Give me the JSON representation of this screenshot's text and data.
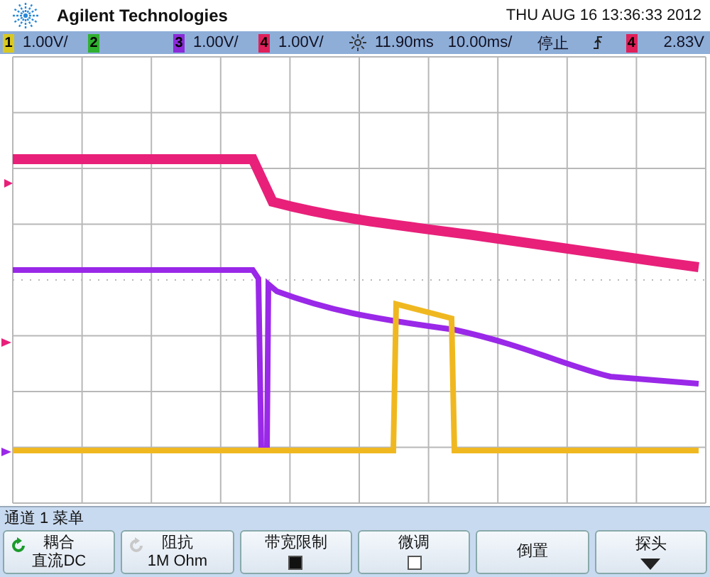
{
  "header": {
    "brand": "Agilent Technologies",
    "datetime": "THU AUG 16 13:36:33 2012"
  },
  "channels": [
    {
      "label": "1",
      "color": "#d8c820",
      "scale": "1.00V/"
    },
    {
      "label": "2",
      "color": "#30b030"
    },
    {
      "label": "3",
      "color": "#8a2ad8",
      "scale": "1.00V/"
    },
    {
      "label": "4",
      "color": "#e0205a",
      "scale": "1.00V/"
    }
  ],
  "timebase": {
    "delay": "11.90ms",
    "scale": "10.00ms/"
  },
  "run_state": "停止",
  "trigger": {
    "source": "4",
    "color": "#e0205a",
    "level": "2.83V"
  },
  "menu_title": "通道 1 菜单",
  "softkeys": [
    {
      "kind": "select",
      "label": "耦合",
      "value": "直流DC",
      "enabled": true
    },
    {
      "kind": "select",
      "label": "阻抗",
      "value": "1M Ohm",
      "enabled": false
    },
    {
      "kind": "checkbox",
      "label": "带宽限制",
      "checked": true
    },
    {
      "kind": "checkbox",
      "label": "微调",
      "checked": false
    },
    {
      "kind": "plain",
      "label": "倒置"
    },
    {
      "kind": "submenu",
      "label": "探头"
    }
  ]
}
